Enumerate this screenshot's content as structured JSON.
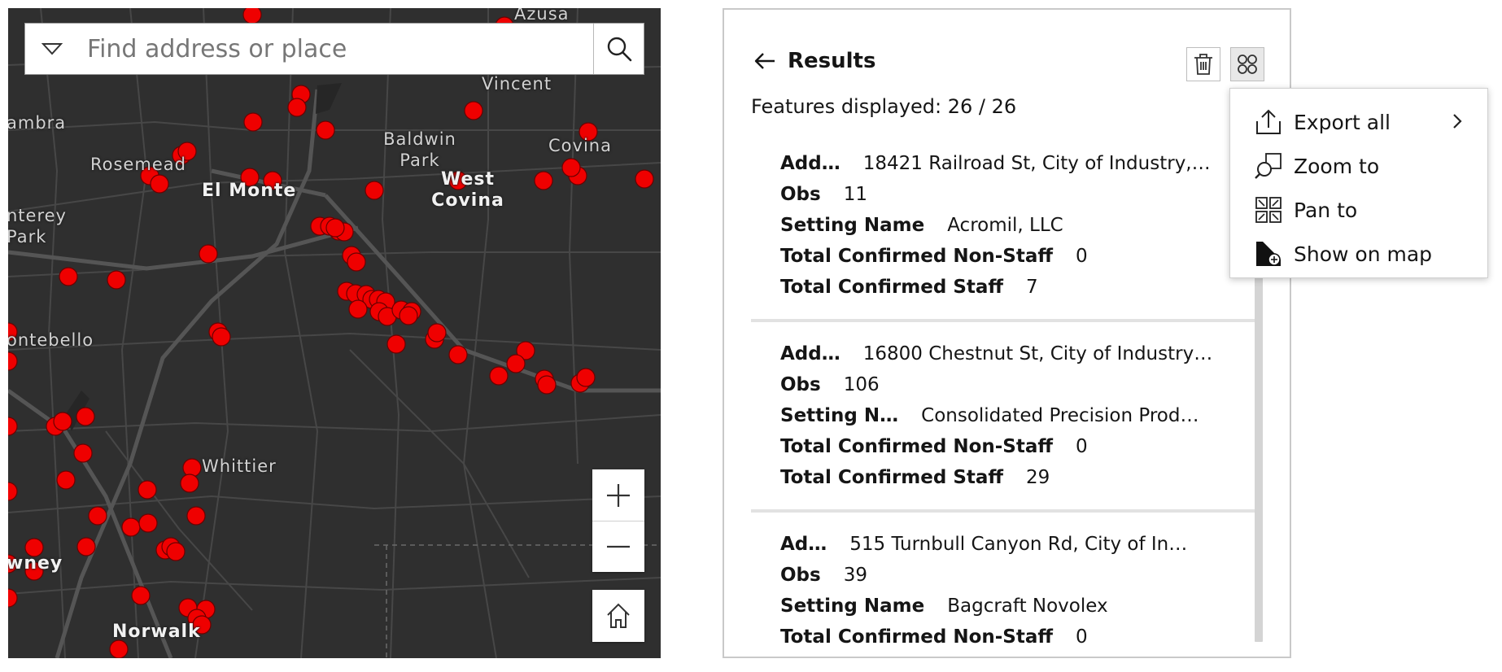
{
  "search": {
    "placeholder": "Find address or place"
  },
  "map": {
    "colors": {
      "background": "#2f2f2f",
      "roads": "#4d4d4d",
      "highways": "#575757",
      "points": "#ef0000",
      "point_outline": "#7a0000"
    },
    "places": [
      {
        "id": "azusa",
        "text": "Azusa"
      },
      {
        "id": "vincent",
        "text": "Vincent"
      },
      {
        "id": "alhambra",
        "text": "ambra"
      },
      {
        "id": "rosemead",
        "text": "Rosemead"
      },
      {
        "id": "baldwin-park",
        "lines": [
          "Baldwin",
          "Park"
        ]
      },
      {
        "id": "covina",
        "text": "Covina"
      },
      {
        "id": "el-monte",
        "text": "El Monte"
      },
      {
        "id": "west-covina",
        "lines": [
          "West",
          "Covina"
        ]
      },
      {
        "id": "monterey-park",
        "lines": [
          "nterey",
          "Park"
        ]
      },
      {
        "id": "montebello",
        "text": "ontebello"
      },
      {
        "id": "whittier",
        "text": "Whittier"
      },
      {
        "id": "downey",
        "text": "wney"
      },
      {
        "id": "norwalk",
        "text": "Norwalk"
      }
    ],
    "controls": {
      "zoom_in": "zoom-in",
      "zoom_out": "zoom-out",
      "home": "home"
    }
  },
  "results": {
    "title": "Results",
    "features_displayed": "Features displayed: 26 / 26",
    "items": [
      {
        "fields": [
          {
            "key": "Add…",
            "value": "18421 Railroad St, City of Industry,…"
          },
          {
            "key": "Obs",
            "value": "11"
          },
          {
            "key": "Setting Name",
            "value": "Acromil, LLC"
          },
          {
            "key": "Total Confirmed Non-Staff",
            "value": "0"
          },
          {
            "key": "Total Confirmed Staff",
            "value": "7"
          }
        ]
      },
      {
        "fields": [
          {
            "key": "Add…",
            "value": "16800 Chestnut St, City of Industry…"
          },
          {
            "key": "Obs",
            "value": "106"
          },
          {
            "key": "Setting N…",
            "value": "Consolidated Precision Prod…"
          },
          {
            "key": "Total Confirmed Non-Staff",
            "value": "0"
          },
          {
            "key": "Total Confirmed Staff",
            "value": "29"
          }
        ]
      },
      {
        "fields": [
          {
            "key": "Ad…",
            "value": "515 Turnbull Canyon Rd, City of In…"
          },
          {
            "key": "Obs",
            "value": "39"
          },
          {
            "key": "Setting Name",
            "value": "Bagcraft Novolex"
          },
          {
            "key": "Total Confirmed Non-Staff",
            "value": "0"
          }
        ]
      }
    ]
  },
  "menu": {
    "items": [
      {
        "label": "Export all",
        "icon": "export-icon",
        "has_submenu": true
      },
      {
        "label": "Zoom to",
        "icon": "zoom-to-icon"
      },
      {
        "label": "Pan to",
        "icon": "pan-to-icon"
      },
      {
        "label": "Show on map",
        "icon": "show-on-map-icon"
      }
    ]
  }
}
